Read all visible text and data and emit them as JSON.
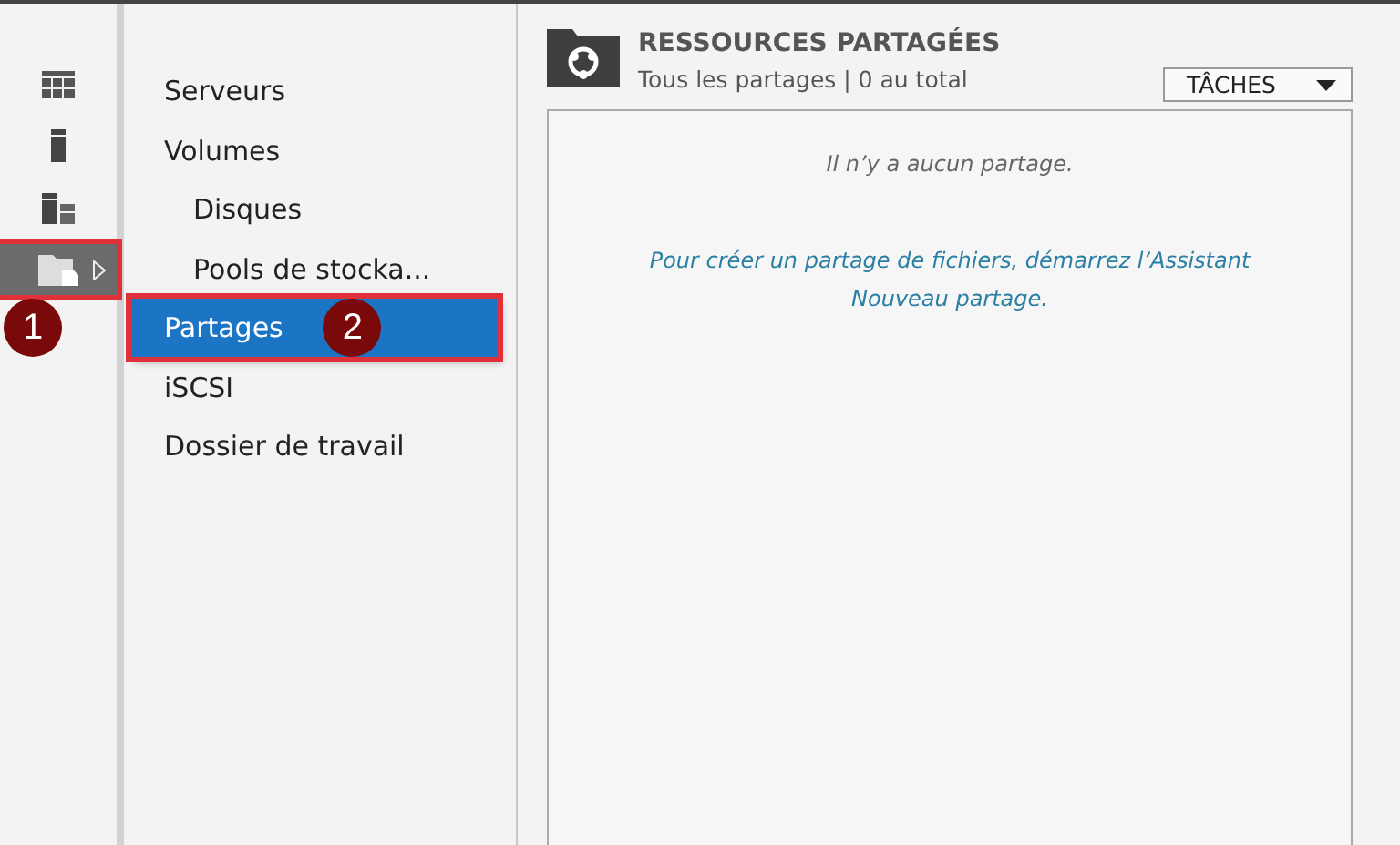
{
  "rail": [
    {
      "kind": "grid",
      "selected": false
    },
    {
      "kind": "server",
      "selected": false
    },
    {
      "kind": "volumes",
      "selected": false
    },
    {
      "kind": "shares",
      "selected": true,
      "badge": "1"
    }
  ],
  "nav": [
    {
      "label": "Serveurs",
      "selected": false
    },
    {
      "label": "Volumes",
      "selected": false,
      "children": [
        {
          "label": "Disques",
          "selected": false
        },
        {
          "label": "Pools de stocka...",
          "selected": false
        }
      ]
    },
    {
      "label": "Partages",
      "selected": true,
      "badge": "2"
    },
    {
      "label": "iSCSI",
      "selected": false
    },
    {
      "label": "Dossier de travail",
      "selected": false
    }
  ],
  "panel": {
    "title": "RESSOURCES PARTAGÉES",
    "subtitle": "Tous les partages | 0 au total",
    "tasks_button": "TÂCHES",
    "empty_message": "Il n’y a aucun partage.",
    "hint_link": "Pour créer un partage de fichiers, démarrez l’Assistant Nouveau partage."
  }
}
